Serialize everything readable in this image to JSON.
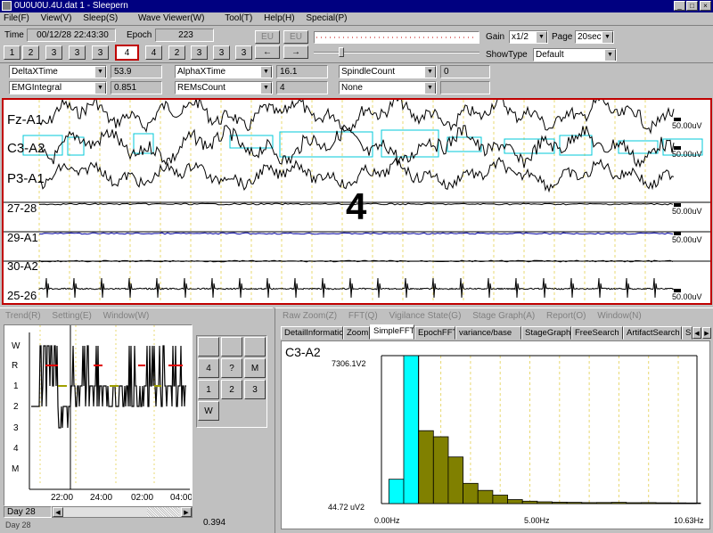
{
  "window": {
    "title": "0U0U0U.4U.dat 1 - Sleepern",
    "icon": "app-icon",
    "controls": [
      "_",
      "□",
      "×"
    ]
  },
  "menu": [
    "File(F)",
    "View(V)",
    "Sleep(S)",
    "Wave Viewer(W)",
    "Tool(T)",
    "Help(H)",
    "Special(P)"
  ],
  "toolbar": {
    "time_label": "Time",
    "time_value": "00/12/28 22:43:30",
    "epoch_label": "Epoch",
    "epoch_value": "223",
    "stage_buttons_left": [
      "1",
      "2",
      "3",
      "3",
      "3"
    ],
    "stage_selected": "4",
    "stage_buttons_right": [
      "4",
      "2",
      "3",
      "3",
      "3"
    ],
    "nav_top": [
      "EU",
      "EU"
    ],
    "nav_bottom": [
      "←",
      "→"
    ],
    "gain_label": "Gain",
    "gain_value": "x1/2",
    "page_label": "Page",
    "page_value": "20sec",
    "show_type_label": "ShowType",
    "show_type_value": "Default"
  },
  "params": {
    "row1": [
      {
        "name": "DeltaXTime",
        "value": "53.9"
      },
      {
        "name": "AlphaXTime",
        "value": "16.1"
      },
      {
        "name": "SpindleCount",
        "value": "0"
      }
    ],
    "row2": [
      {
        "name": "EMGIntegral",
        "value": "0.851"
      },
      {
        "name": "REMsCount",
        "value": "4"
      },
      {
        "name": "None",
        "value": ""
      }
    ]
  },
  "eeg": {
    "stage_overlay": "4",
    "channels": [
      {
        "label": "Fz-A1",
        "scale": "50.00uV"
      },
      {
        "label": "C3-A2",
        "scale": "50.00uV"
      },
      {
        "label": "P3-A1",
        "scale": ""
      },
      {
        "label": "27-28",
        "scale": "50.00uV"
      },
      {
        "label": "29-A1",
        "scale": "50.00uV"
      },
      {
        "label": "30-A2",
        "scale": ""
      },
      {
        "label": "25-26",
        "scale": "50.00uV"
      }
    ]
  },
  "trend": {
    "menu": [
      "Trend(R)",
      "Setting(E)",
      "Window(W)"
    ],
    "y_labels": [
      "W",
      "R",
      "1",
      "2",
      "3",
      "4",
      "M"
    ],
    "x_labels": [
      "22:00",
      "24:00",
      "02:00",
      "04:00"
    ],
    "day_label": "Day 28",
    "bottom_value": "0.394",
    "bottom_left": "Day 28"
  },
  "keypad": {
    "rows": [
      [
        "",
        "",
        ""
      ],
      [
        "4",
        "?",
        "M"
      ],
      [
        "1",
        "2",
        "3"
      ],
      [
        "W",
        "",
        ""
      ]
    ]
  },
  "analysis": {
    "menu": [
      "Raw Zoom(Z)",
      "FFT(Q)",
      "Vigilance State(G)",
      "Stage Graph(A)",
      "Report(O)",
      "Window(N)"
    ],
    "tabs": [
      "DetailInformation",
      "Zoom",
      "SimpleFFT",
      "EpochFFT",
      "variance/base",
      "StageGraph",
      "FreeSearch",
      "ArtifactSearch",
      "S"
    ],
    "active_tab": "SimpleFFT",
    "channel": "C3-A2",
    "y_top": "7306.1V2",
    "y_bottom": "44.72 uV2",
    "x_left": "0.00Hz",
    "x_mid": "5.00Hz",
    "x_right": "10.63Hz"
  },
  "chart_data": {
    "type": "bar",
    "title": "C3-A2",
    "x": [
      0.5,
      1.0,
      1.5,
      2.0,
      2.5,
      3.0,
      3.5,
      4.0,
      4.5,
      5.0,
      5.5,
      6.0,
      6.5,
      7.0,
      7.5,
      8.0,
      8.5,
      9.0,
      9.5,
      10.0,
      10.5
    ],
    "values": [
      1200,
      7306,
      3600,
      3300,
      2300,
      1000,
      650,
      420,
      200,
      120,
      90,
      70,
      60,
      50,
      55,
      60,
      45,
      50,
      40,
      35,
      30
    ],
    "highlight_color": "#00ffff",
    "bar_color": "#808000",
    "highlight_count": 2,
    "ylim": [
      44.72,
      7306
    ],
    "xlim": [
      0,
      10.63
    ]
  }
}
